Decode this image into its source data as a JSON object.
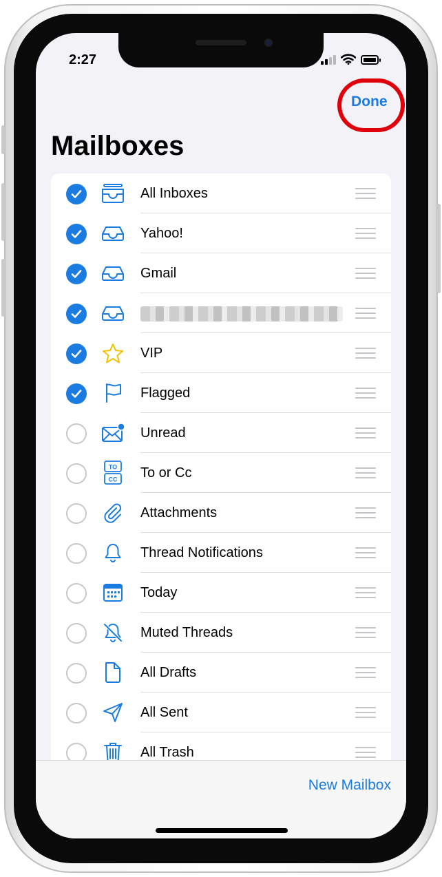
{
  "status_bar": {
    "time": "2:27"
  },
  "nav": {
    "done_label": "Done"
  },
  "page": {
    "title": "Mailboxes"
  },
  "mailboxes": [
    {
      "label": "All Inboxes",
      "checked": true,
      "icon": "tray-stack-icon"
    },
    {
      "label": "Yahoo!",
      "checked": true,
      "icon": "tray-icon"
    },
    {
      "label": "Gmail",
      "checked": true,
      "icon": "tray-icon"
    },
    {
      "label": "",
      "checked": true,
      "icon": "tray-icon",
      "redacted": true
    },
    {
      "label": "VIP",
      "checked": true,
      "icon": "star-icon"
    },
    {
      "label": "Flagged",
      "checked": true,
      "icon": "flag-icon"
    },
    {
      "label": "Unread",
      "checked": false,
      "icon": "envelope-badge-icon"
    },
    {
      "label": "To or Cc",
      "checked": false,
      "icon": "to-cc-icon"
    },
    {
      "label": "Attachments",
      "checked": false,
      "icon": "paperclip-icon"
    },
    {
      "label": "Thread Notifications",
      "checked": false,
      "icon": "bell-icon"
    },
    {
      "label": "Today",
      "checked": false,
      "icon": "calendar-icon"
    },
    {
      "label": "Muted Threads",
      "checked": false,
      "icon": "bell-slash-icon"
    },
    {
      "label": "All Drafts",
      "checked": false,
      "icon": "document-icon"
    },
    {
      "label": "All Sent",
      "checked": false,
      "icon": "paperplane-icon"
    },
    {
      "label": "All Trash",
      "checked": false,
      "icon": "trash-icon"
    }
  ],
  "to_cc_icon_text": {
    "top": "TO",
    "bottom": "CC"
  },
  "toolbar": {
    "new_mailbox_label": "New Mailbox"
  },
  "colors": {
    "accent": "#1a7be0",
    "highlight": "#e0000b",
    "star": "#f2c200"
  }
}
